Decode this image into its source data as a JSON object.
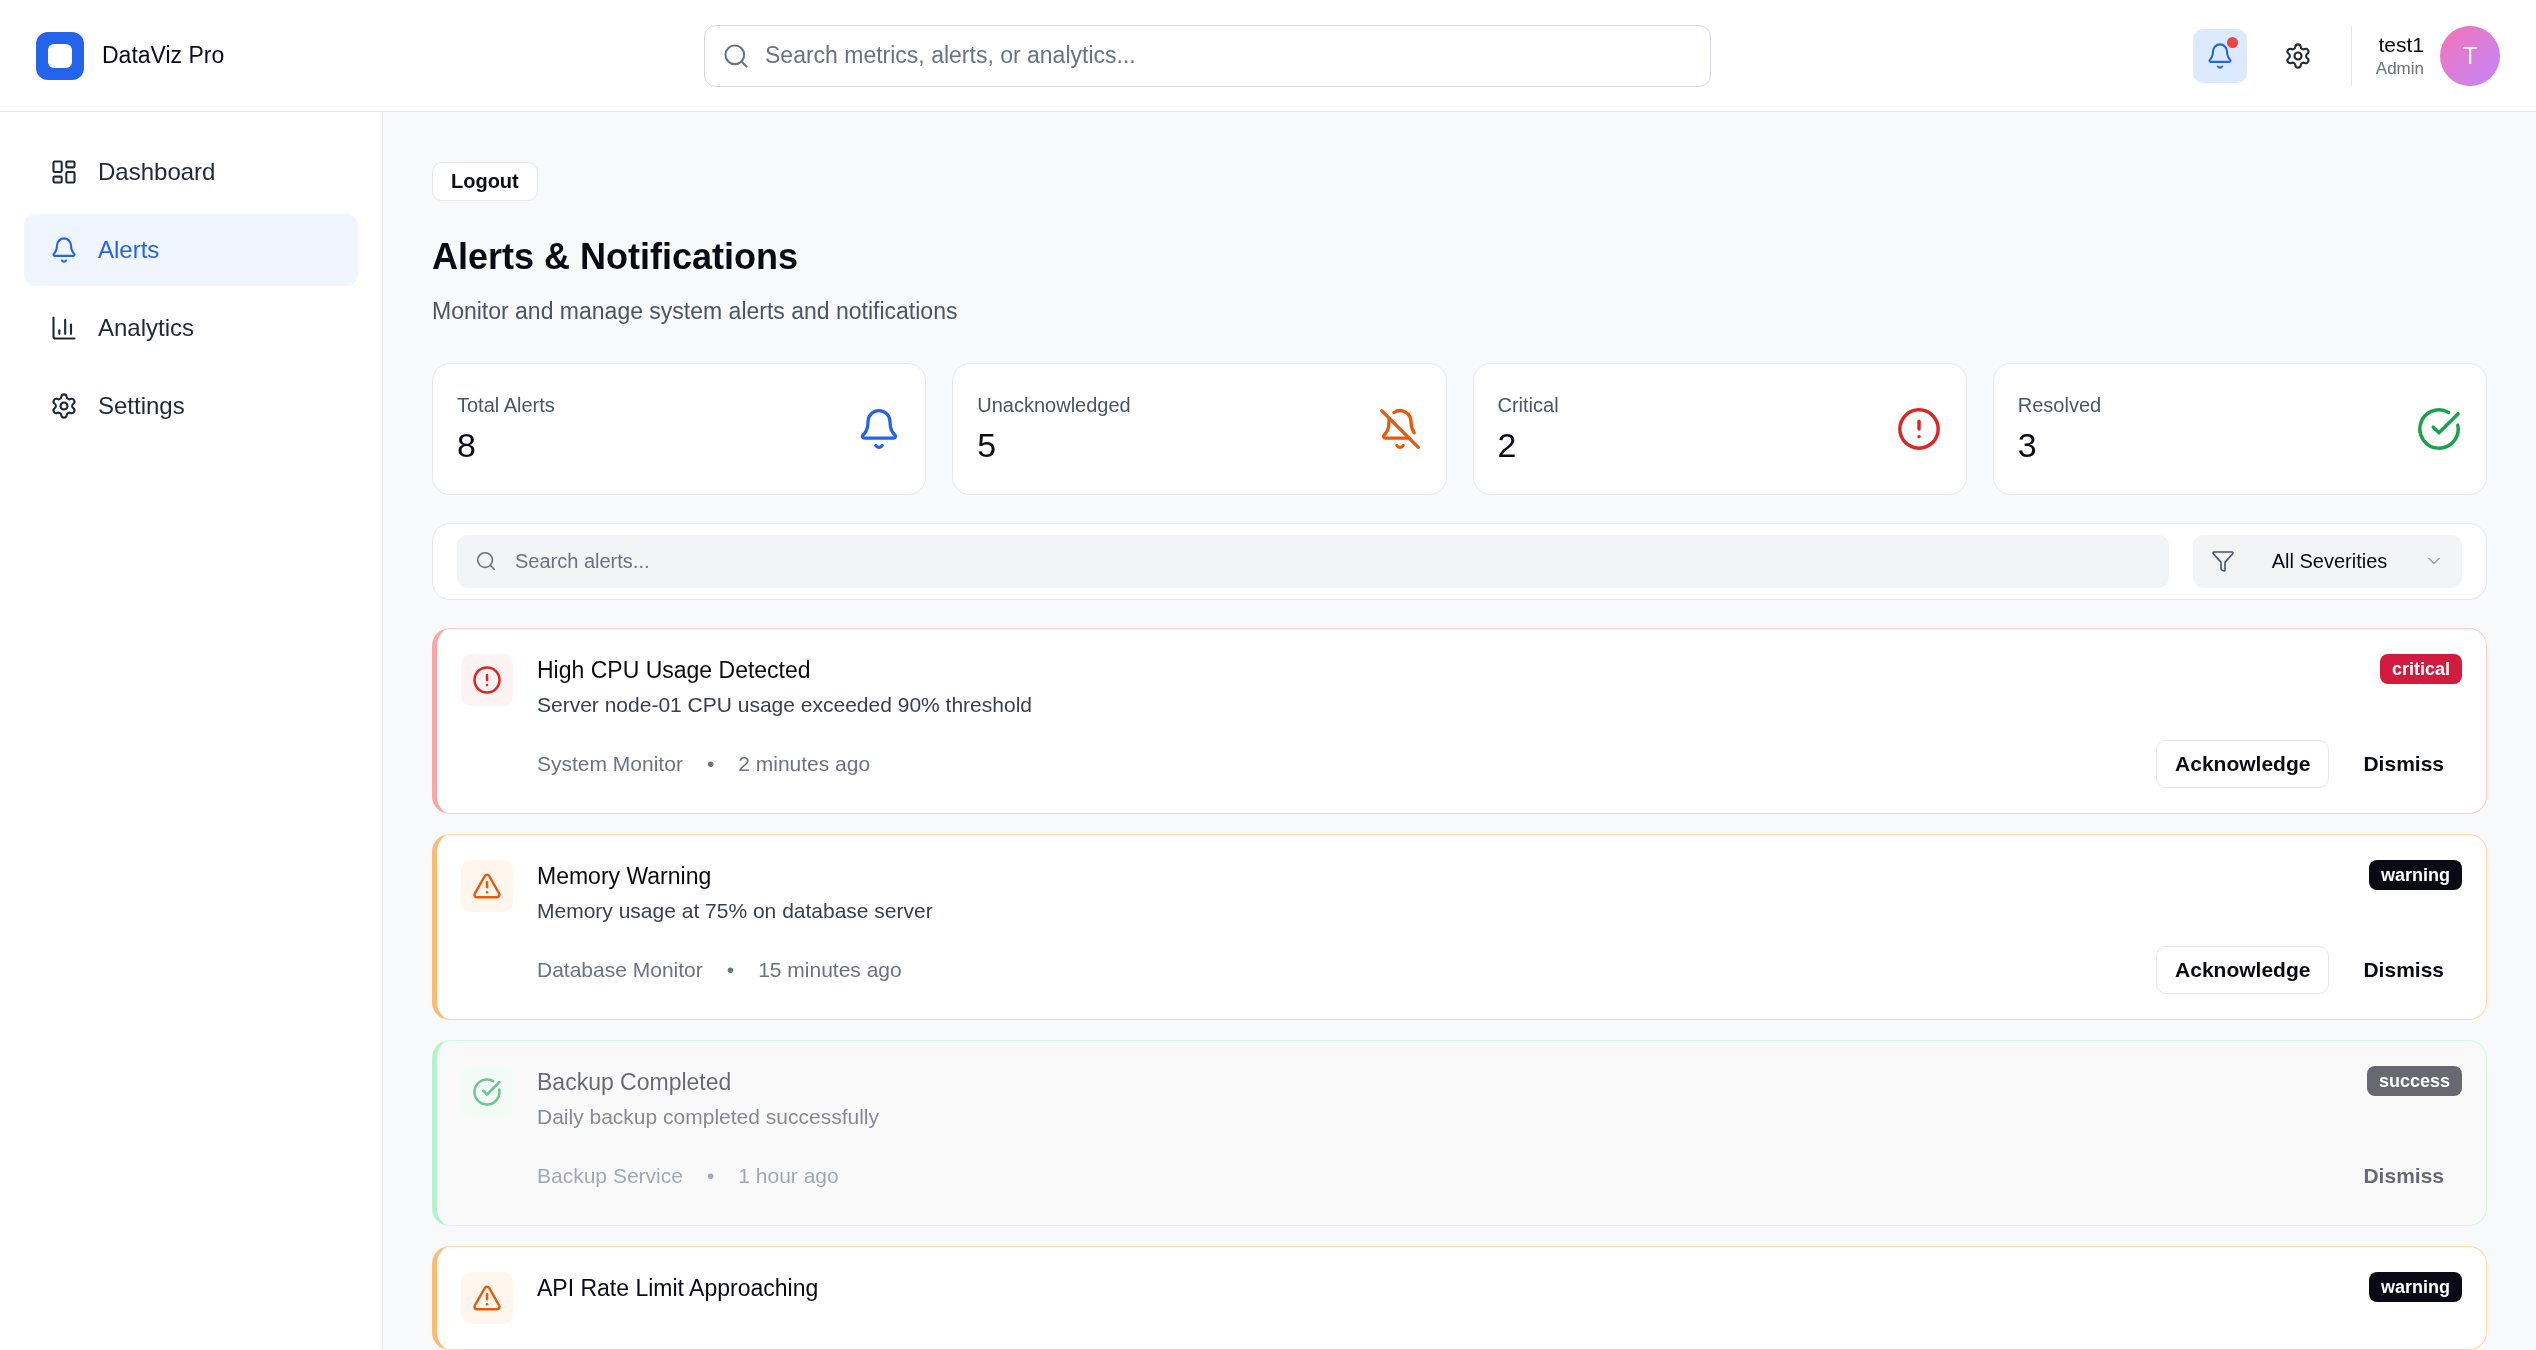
{
  "header": {
    "app_name": "DataViz Pro",
    "search_placeholder": "Search metrics, alerts, or analytics...",
    "notifications": {
      "unread": true
    },
    "user": {
      "name": "test1",
      "role": "Admin",
      "initial": "T"
    }
  },
  "sidebar": {
    "items": [
      {
        "label": "Dashboard",
        "kind": "dashboard",
        "selected": false
      },
      {
        "label": "Alerts",
        "kind": "alerts",
        "selected": true
      },
      {
        "label": "Analytics",
        "kind": "analytics",
        "selected": false
      },
      {
        "label": "Settings",
        "kind": "settings",
        "selected": false
      }
    ]
  },
  "logout_button": "Logout",
  "page": {
    "title": "Alerts & Notifications",
    "subtitle": "Monitor and manage system alerts and notifications"
  },
  "stats": [
    {
      "label": "Total Alerts",
      "value": "8",
      "kind": "total"
    },
    {
      "label": "Unacknowledged",
      "value": "5",
      "kind": "unacknowledged"
    },
    {
      "label": "Critical",
      "value": "2",
      "kind": "critical"
    },
    {
      "label": "Resolved",
      "value": "3",
      "kind": "resolved"
    }
  ],
  "filter": {
    "search_placeholder": "Search alerts...",
    "severity": "All Severities"
  },
  "alerts": [
    {
      "title": "High CPU Usage Detected",
      "description": "Server node-01 CPU usage exceeded 90% threshold",
      "source": "System Monitor",
      "separator": "•",
      "time": "2 minutes ago",
      "severity": "critical",
      "resolved": false,
      "actions": [
        {
          "label": "Acknowledge",
          "kind": "outline"
        },
        {
          "label": "Dismiss",
          "kind": "ghost"
        }
      ]
    },
    {
      "title": "Memory Warning",
      "description": "Memory usage at 75% on database server",
      "source": "Database Monitor",
      "separator": "•",
      "time": "15 minutes ago",
      "severity": "warning",
      "resolved": false,
      "actions": [
        {
          "label": "Acknowledge",
          "kind": "outline"
        },
        {
          "label": "Dismiss",
          "kind": "ghost"
        }
      ]
    },
    {
      "title": "Backup Completed",
      "description": "Daily backup completed successfully",
      "source": "Backup Service",
      "separator": "•",
      "time": "1 hour ago",
      "severity": "success",
      "resolved": true,
      "actions": [
        {
          "label": "Dismiss",
          "kind": "ghost"
        }
      ]
    },
    {
      "title": "API Rate Limit Approaching",
      "severity": "warning",
      "resolved": false
    }
  ]
}
